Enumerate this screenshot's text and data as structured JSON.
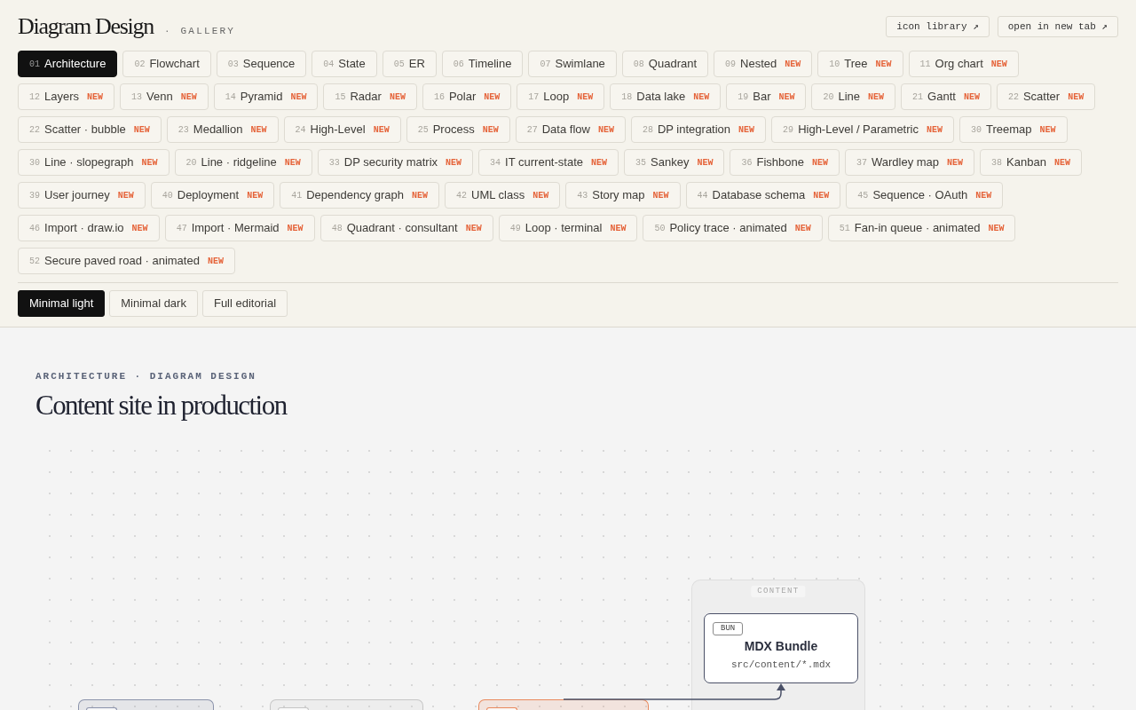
{
  "header": {
    "title": "Diagram Design",
    "separator": "·",
    "subtitle": "GALLERY",
    "links": [
      {
        "label": "icon library ↗"
      },
      {
        "label": "open in new tab ↗"
      }
    ]
  },
  "diagram_types": [
    [
      {
        "number": "01",
        "label": "Architecture",
        "selected": true
      },
      {
        "number": "02",
        "label": "Flowchart",
        "selected": false
      },
      {
        "number": "03",
        "label": "Sequence",
        "selected": false
      },
      {
        "number": "04",
        "label": "State",
        "selected": false
      },
      {
        "number": "05",
        "label": "ER",
        "selected": false
      },
      {
        "number": "06",
        "label": "Timeline",
        "selected": false
      },
      {
        "number": "07",
        "label": "Swimlane",
        "selected": false
      },
      {
        "number": "08",
        "label": "Quadrant",
        "selected": false
      },
      {
        "number": "09",
        "label": "Nested",
        "badge": "NEW",
        "selected": false
      },
      {
        "number": "10",
        "label": "Tree",
        "badge": "NEW",
        "selected": false
      },
      {
        "number": "11",
        "label": "Org chart",
        "badge": "NEW",
        "selected": false
      }
    ],
    [
      {
        "number": "12",
        "label": "Layers",
        "badge": "NEW",
        "selected": false
      },
      {
        "number": "13",
        "label": "Venn",
        "badge": "NEW",
        "selected": false
      },
      {
        "number": "14",
        "label": "Pyramid",
        "badge": "NEW",
        "selected": false
      },
      {
        "number": "15",
        "label": "Radar",
        "badge": "NEW",
        "selected": false
      },
      {
        "number": "16",
        "label": "Polar",
        "badge": "NEW",
        "selected": false
      },
      {
        "number": "17",
        "label": "Loop",
        "badge": "NEW",
        "selected": false
      },
      {
        "number": "18",
        "label": "Data lake",
        "badge": "NEW",
        "selected": false
      },
      {
        "number": "19",
        "label": "Bar",
        "badge": "NEW",
        "selected": false
      },
      {
        "number": "20",
        "label": "Line",
        "badge": "NEW",
        "selected": false
      },
      {
        "number": "21",
        "label": "Gantt",
        "badge": "NEW",
        "selected": false
      },
      {
        "number": "22",
        "label": "Scatter",
        "badge": "NEW",
        "selected": false
      }
    ],
    [
      {
        "number": "22",
        "label": "Scatter · bubble",
        "badge": "NEW",
        "selected": false
      },
      {
        "number": "23",
        "label": "Medallion",
        "badge": "NEW",
        "selected": false
      },
      {
        "number": "24",
        "label": "High-Level",
        "badge": "NEW",
        "selected": false
      },
      {
        "number": "25",
        "label": "Process",
        "badge": "NEW",
        "selected": false
      },
      {
        "number": "27",
        "label": "Data flow",
        "badge": "NEW",
        "selected": false
      },
      {
        "number": "28",
        "label": "DP integration",
        "badge": "NEW",
        "selected": false
      },
      {
        "number": "29",
        "label": "High-Level / Parametric",
        "badge": "NEW",
        "selected": false
      },
      {
        "number": "30",
        "label": "Treemap",
        "badge": "NEW",
        "selected": false
      }
    ],
    [
      {
        "number": "30",
        "label": "Line · slopegraph",
        "badge": "NEW",
        "selected": false
      },
      {
        "number": "20",
        "label": "Line · ridgeline",
        "badge": "NEW",
        "selected": false
      },
      {
        "number": "33",
        "label": "DP security matrix",
        "badge": "NEW",
        "selected": false
      },
      {
        "number": "34",
        "label": "IT current-state",
        "badge": "NEW",
        "selected": false
      },
      {
        "number": "35",
        "label": "Sankey",
        "badge": "NEW",
        "selected": false
      },
      {
        "number": "36",
        "label": "Fishbone",
        "badge": "NEW",
        "selected": false
      },
      {
        "number": "37",
        "label": "Wardley map",
        "badge": "NEW",
        "selected": false
      },
      {
        "number": "38",
        "label": "Kanban",
        "badge": "NEW",
        "selected": false
      }
    ],
    [
      {
        "number": "39",
        "label": "User journey",
        "badge": "NEW",
        "selected": false
      },
      {
        "number": "40",
        "label": "Deployment",
        "badge": "NEW",
        "selected": false
      },
      {
        "number": "41",
        "label": "Dependency graph",
        "badge": "NEW",
        "selected": false
      },
      {
        "number": "42",
        "label": "UML class",
        "badge": "NEW",
        "selected": false
      },
      {
        "number": "43",
        "label": "Story map",
        "badge": "NEW",
        "selected": false
      },
      {
        "number": "44",
        "label": "Database schema",
        "badge": "NEW",
        "selected": false
      },
      {
        "number": "45",
        "label": "Sequence · OAuth",
        "badge": "NEW",
        "selected": false
      }
    ],
    [
      {
        "number": "46",
        "label": "Import · draw.io",
        "badge": "NEW",
        "selected": false
      },
      {
        "number": "47",
        "label": "Import · Mermaid",
        "badge": "NEW",
        "selected": false
      },
      {
        "number": "48",
        "label": "Quadrant · consultant",
        "badge": "NEW",
        "selected": false
      },
      {
        "number": "49",
        "label": "Loop · terminal",
        "badge": "NEW",
        "selected": false
      },
      {
        "number": "50",
        "label": "Policy trace · animated",
        "badge": "NEW",
        "selected": false
      },
      {
        "number": "51",
        "label": "Fan-in queue · animated",
        "badge": "NEW",
        "selected": false
      }
    ],
    [
      {
        "number": "52",
        "label": "Secure paved road · animated",
        "badge": "NEW",
        "selected": false
      }
    ]
  ],
  "themes": [
    {
      "label": "Minimal light",
      "selected": true
    },
    {
      "label": "Minimal dark",
      "selected": false
    },
    {
      "label": "Full editorial",
      "selected": false
    }
  ],
  "page": {
    "breadcrumb": "ARCHITECTURE · DIAGRAM DESIGN",
    "title": "Content site in production"
  },
  "diagram": {
    "group": {
      "label": "CONTENT",
      "node": {
        "tag": "BUN",
        "title": "MDX Bundle",
        "path": "src/content/*.mdx"
      }
    },
    "partial_nodes": [
      {
        "color": "#8b93ab",
        "connected": false
      },
      {
        "color": "#c6c6c6",
        "connected": false
      },
      {
        "color": "#e9895d",
        "connected": true
      }
    ]
  }
}
